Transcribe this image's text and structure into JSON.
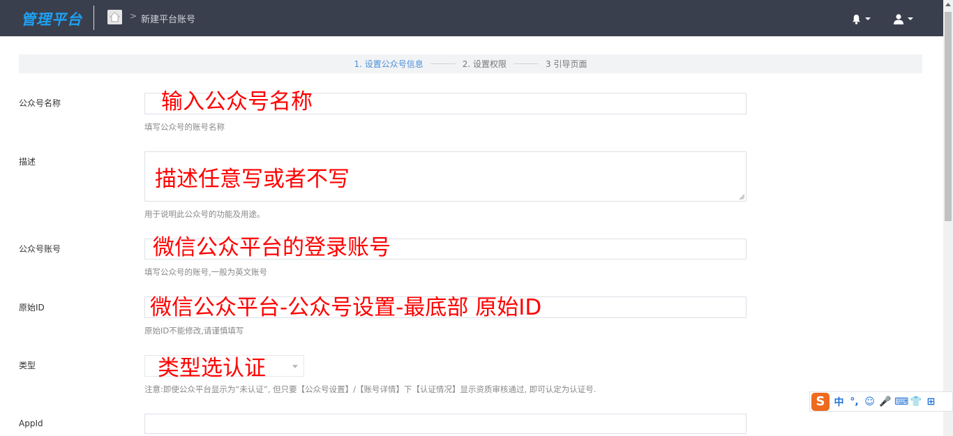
{
  "header": {
    "logo": "管理平台",
    "breadcrumb": ">",
    "page": "新建平台账号"
  },
  "steps": [
    {
      "label": "1. 设置公众号信息"
    },
    {
      "label": "2. 设置权限"
    },
    {
      "label": "3 引导页面"
    }
  ],
  "form": {
    "name": {
      "label": "公众号名称",
      "help": "填写公众号的账号名称",
      "annotation": "输入公众号名称"
    },
    "desc": {
      "label": "描述",
      "help": "用于说明此公众号的功能及用途。",
      "annotation": "描述任意写或者不写"
    },
    "account": {
      "label": "公众号账号",
      "help": "填写公众号的账号,一般为英文账号",
      "annotation": "微信公众平台的登录账号"
    },
    "origid": {
      "label": "原始ID",
      "help": "原始ID不能修改,请谨慎填写",
      "annotation": "微信公众平台-公众号设置-最底部 原始ID"
    },
    "type": {
      "label": "类型",
      "help": "注意:即使公众平台显示为“未认证”, 但只要【公众号设置】/【账号详情】下【认证情况】显示资质审核通过, 即可认定为认证号.",
      "annotation": "类型选认证"
    },
    "appid": {
      "label": "AppId"
    }
  },
  "ime": {
    "logo": "S",
    "items": [
      "中",
      "°,",
      "☺",
      "🎤",
      "⌨",
      "👕",
      "⊞"
    ]
  },
  "colors": {
    "topbar": "#3a3f4d",
    "logo": "#1da1f2",
    "step_active": "#4a90d9",
    "annotation": "#ff0000",
    "ime_logo": "#ee6a1f"
  }
}
